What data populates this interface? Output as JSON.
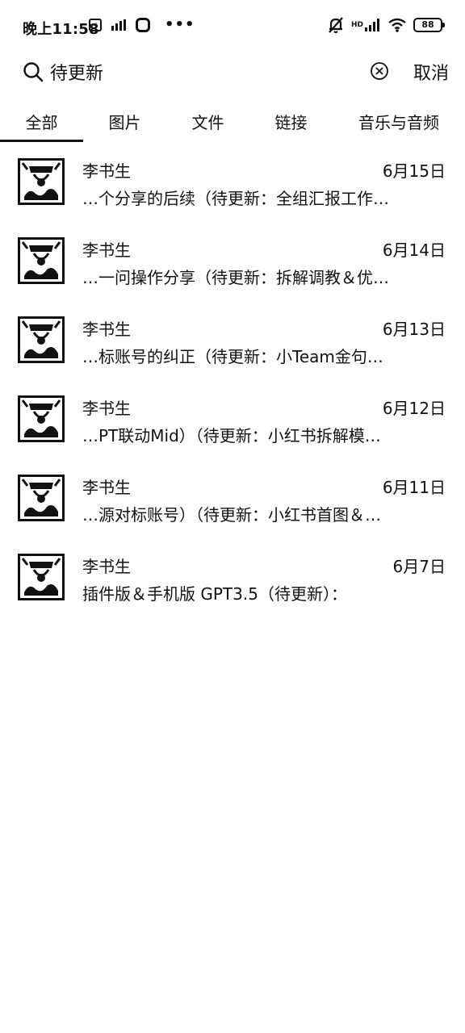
{
  "status_bar": {
    "time": "晚上11:58",
    "hd_label": "HD",
    "battery": "88"
  },
  "search": {
    "query": "待更新",
    "cancel_label": "取消"
  },
  "tabs": [
    {
      "label": "全部",
      "active": true
    },
    {
      "label": "图片",
      "active": false
    },
    {
      "label": "文件",
      "active": false
    },
    {
      "label": "链接",
      "active": false
    },
    {
      "label": "音乐与音频",
      "active": false
    }
  ],
  "results": [
    {
      "sender": "李书生",
      "date": "6月15日",
      "snippet": "…个分享的后续（待更新：全组汇报工作…"
    },
    {
      "sender": "李书生",
      "date": "6月14日",
      "snippet": "…一问操作分享（待更新：拆解调教＆优…"
    },
    {
      "sender": "李书生",
      "date": "6月13日",
      "snippet": "…标账号的纠正（待更新：小Team金句…"
    },
    {
      "sender": "李书生",
      "date": "6月12日",
      "snippet": "…PT联动Mid）（待更新：小红书拆解模…"
    },
    {
      "sender": "李书生",
      "date": "6月11日",
      "snippet": "…源对标账号）（待更新：小红书首图＆…"
    },
    {
      "sender": "李书生",
      "date": "6月7日",
      "snippet": "插件版＆手机版 GPT3.5（待更新）："
    }
  ]
}
